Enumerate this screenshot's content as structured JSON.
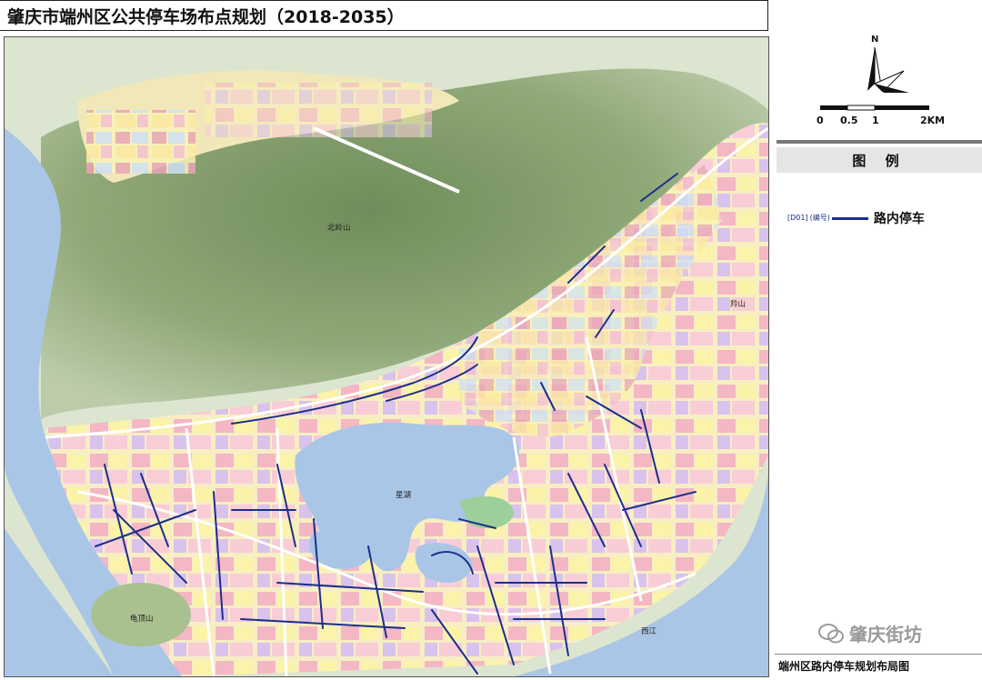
{
  "title": "肇庆市端州区公共停车场布点规划（2018-2035）",
  "compass": {
    "north_label": "N"
  },
  "scale_bar": {
    "ticks": [
      "0",
      "0.5",
      "1",
      "2KM"
    ]
  },
  "legend": {
    "heading": "图 例",
    "items": [
      {
        "code": "[D01]",
        "note": "(编号)",
        "label": "路内停车",
        "color": "#1b2f8a"
      }
    ]
  },
  "map": {
    "place_labels": {
      "beiling": "北岭山",
      "lingshan": "羚山",
      "xinghu": "星湖",
      "guidingshan": "龟顶山",
      "xijiang": "西江"
    },
    "colors": {
      "water": "#a9c6e6",
      "mountain": "#8fa877",
      "route": "#1b2f8a"
    }
  },
  "watermark": {
    "text": "肇庆街坊"
  },
  "footer": {
    "caption": "端州区路内停车规划布局图"
  }
}
